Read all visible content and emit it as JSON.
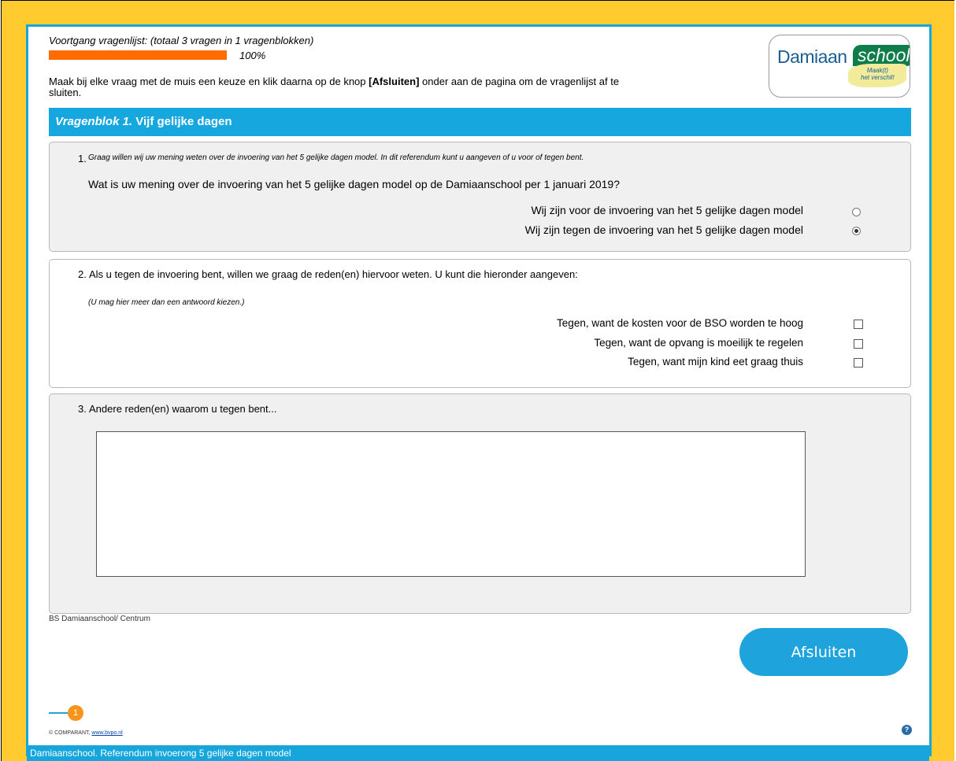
{
  "progress": {
    "label": "Voortgang vragenlijst: (totaal 3 vragen in 1 vragenblokken)",
    "percent_text": "100%",
    "fraction": 1.0,
    "color": "#ff6b00"
  },
  "instructions": {
    "before": "Maak bij elke vraag met de muis een keuze en klik daarna op de knop ",
    "button_ref": "[Afsluiten]",
    "after": " onder aan de pagina om de vragenlijst af te sluiten."
  },
  "logo": {
    "word1": "Damiaan",
    "word2": "school",
    "tagline_line1": "Maak(t)",
    "tagline_line2": "het verschil!"
  },
  "block": {
    "title_italic": "Vragenblok 1.",
    "title_rest": " Vijf gelijke dagen",
    "color": "#16a7df"
  },
  "q1": {
    "number": "1.",
    "note": "Graag willen wij uw mening weten over de invoering van het 5 gelijke dagen model. In dit referendum kunt u aangeven of u voor of tegen bent.",
    "question": "Wat is uw mening over de invoering van het 5 gelijke dagen model op de Damiaanschool per 1 januari 2019?",
    "options": [
      {
        "label": "Wij zijn voor de invoering van het 5 gelijke dagen model",
        "checked": false
      },
      {
        "label": "Wij zijn tegen de invoering van het 5 gelijke dagen model",
        "checked": true
      }
    ]
  },
  "q2": {
    "number": "2.",
    "question": "Als u tegen de invoering bent, willen we graag de reden(en) hiervoor weten. U kunt die hieronder aangeven:",
    "note": "(U mag hier meer dan een antwoord kiezen.)",
    "options": [
      {
        "label": "Tegen, want de kosten voor de BSO worden te hoog",
        "checked": false
      },
      {
        "label": "Tegen, want de opvang is moeilijk te regelen",
        "checked": false
      },
      {
        "label": "Tegen, want mijn kind eet graag thuis",
        "checked": false
      }
    ]
  },
  "q3": {
    "number": "3.",
    "question": "Andere reden(en) waarom u tegen bent...",
    "value": ""
  },
  "school_label": "BS Damiaanschool/ Centrum",
  "submit_label": "Afsluiten",
  "pager": {
    "current": "1"
  },
  "copyright": {
    "text": "© COMPARANT, ",
    "link": "www.bvpo.nl"
  },
  "help_glyph": "?",
  "footer": "Damiaanschool. Referendum invoerong 5 gelijke dagen model",
  "colors": {
    "background": "#ffcb2f",
    "accent": "#17a6dc",
    "button": "#1ea3dc",
    "pager_dot": "#f7941d"
  }
}
